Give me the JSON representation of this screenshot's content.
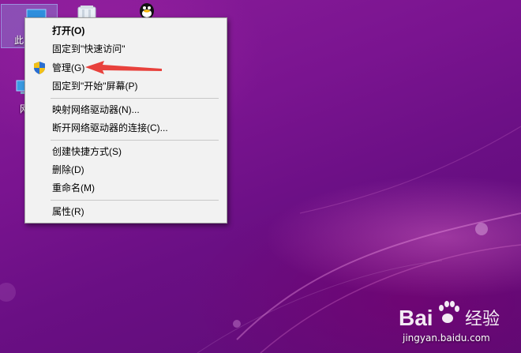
{
  "desktop": {
    "icons": [
      {
        "label": "此"
      },
      {
        "label": "网"
      }
    ]
  },
  "context_menu": {
    "items": [
      {
        "label": "打开(O)"
      },
      {
        "label": "固定到\"快速访问\""
      },
      {
        "label": "管理(G)",
        "icon": "shield-icon"
      },
      {
        "label": "固定到\"开始\"屏幕(P)"
      },
      {
        "label": "映射网络驱动器(N)..."
      },
      {
        "label": "断开网络驱动器的连接(C)..."
      },
      {
        "label": "创建快捷方式(S)"
      },
      {
        "label": "删除(D)"
      },
      {
        "label": "重命名(M)"
      },
      {
        "label": "属性(R)"
      }
    ]
  },
  "annotation": {
    "color": "#e8413c"
  },
  "watermark": {
    "logo_text": "Bai",
    "logo_suffix": "经验",
    "url": "jingyan.baidu.com"
  }
}
